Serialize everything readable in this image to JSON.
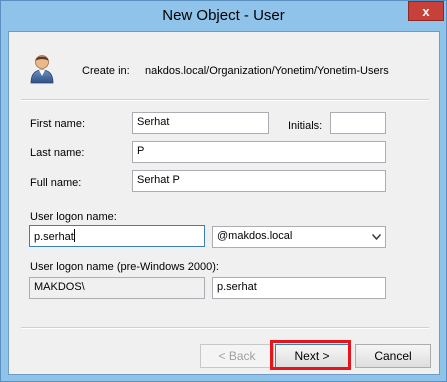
{
  "window": {
    "title": "New Object - User",
    "close_glyph": "x"
  },
  "header": {
    "user_icon": "user-icon",
    "create_in_label": "Create in:",
    "create_in_path": "nakdos.local/Organization/Yonetim/Yonetim-Users"
  },
  "form": {
    "first_name_label": "First name:",
    "first_name_value": "Serhat",
    "initials_label": "Initials:",
    "initials_value": "",
    "last_name_label": "Last name:",
    "last_name_value": "P",
    "full_name_label": "Full name:",
    "full_name_value": "Serhat P",
    "logon_name_label": "User logon name:",
    "logon_name_value": "p.serhat",
    "domain_value": "@makdos.local",
    "pre2000_label": "User logon name (pre-Windows 2000):",
    "pre2000_domain_value": "MAKDOS\\",
    "pre2000_user_value": "p.serhat"
  },
  "buttons": {
    "back_label": "< Back",
    "next_label": "Next >",
    "cancel_label": "Cancel"
  },
  "colors": {
    "titlebar": "#8fc3ea",
    "highlight": "#e8141b",
    "close_button": "#c8403a"
  }
}
